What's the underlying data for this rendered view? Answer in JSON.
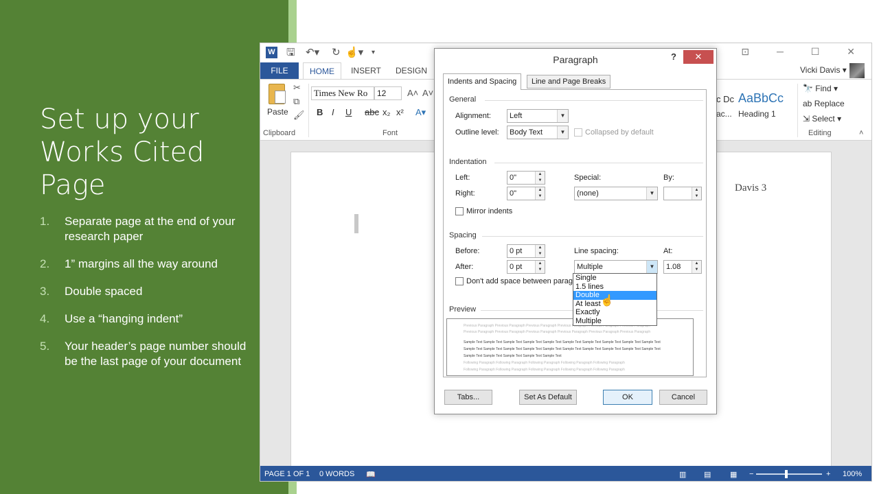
{
  "slide": {
    "title": "Set up your Works Cited Page",
    "items": [
      {
        "num": "1.",
        "text": "Separate page at the end of your research paper"
      },
      {
        "num": "2.",
        "text": "1” margins all the way around"
      },
      {
        "num": "3.",
        "text": "Double spaced"
      },
      {
        "num": "4.",
        "text": "Use a “hanging indent”"
      },
      {
        "num": "5.",
        "text": "Your header’s page number should be the last page of your document"
      }
    ],
    "colors": {
      "panel": "#548235",
      "accent": "#a9d18e"
    }
  },
  "word": {
    "app_badge": "W",
    "tabs": {
      "file": "FILE",
      "home": "HOME",
      "insert": "INSERT",
      "design": "DESIGN"
    },
    "user_name": "Vicki Davis ▾",
    "ribbon": {
      "paste_label": "Paste",
      "font_name": "Times New Ro",
      "font_size": "12",
      "bold": "B",
      "italic": "I",
      "underline": "U",
      "clipboard_label": "Clipboard",
      "font_label": "Font",
      "styles_preview_left": "c Dc",
      "styles_name_left": "ac...",
      "styles_preview": "AaBbCc",
      "styles_name": "Heading 1",
      "find": "Find ▾",
      "replace": "Replace",
      "select": "Select ▾",
      "editing_label": "Editing"
    },
    "doc": {
      "header_number": "Davis 3"
    },
    "status": {
      "page": "PAGE 1 OF 1",
      "words": "0 WORDS",
      "zoom": "100%"
    }
  },
  "dialog": {
    "title": "Paragraph",
    "help": "?",
    "close": "✕",
    "tabs": {
      "indents": "Indents and Spacing",
      "line_breaks": "Line and Page Breaks"
    },
    "general": {
      "heading": "General",
      "alignment_label": "Alignment:",
      "alignment_value": "Left",
      "outline_label": "Outline level:",
      "outline_value": "Body Text",
      "collapsed_label": "Collapsed by default"
    },
    "indentation": {
      "heading": "Indentation",
      "left_label": "Left:",
      "left_value": "0\"",
      "right_label": "Right:",
      "right_value": "0\"",
      "special_label": "Special:",
      "special_value": "(none)",
      "by_label": "By:",
      "by_value": "",
      "mirror_label": "Mirror indents"
    },
    "spacing": {
      "heading": "Spacing",
      "before_label": "Before:",
      "before_value": "0 pt",
      "after_label": "After:",
      "after_value": "0 pt",
      "line_spacing_label": "Line spacing:",
      "line_spacing_value": "Multiple",
      "at_label": "At:",
      "at_value": "1.08",
      "dont_add_label": "Don't add space between parag"
    },
    "line_spacing_options": [
      "Single",
      "1.5 lines",
      "Double",
      "At least",
      "Exactly",
      "Multiple"
    ],
    "highlighted_option_index": 2,
    "preview": {
      "heading": "Preview",
      "prev_para": "Previous Paragraph Previous Paragraph Previous Paragraph Previous Paragraph Previous Paragraph Previous Paragraph",
      "sample": "Sample Text Sample Text Sample Text Sample Text Sample Text Sample Text Sample Text Sample Text Sample Text Sample Text",
      "sample_end": "Sample Text Sample Text Sample Text Sample Text Sample Text",
      "following": "Following Paragraph Following Paragraph Following Paragraph Following Paragraph Following Paragraph"
    },
    "buttons": {
      "tabs": "Tabs...",
      "set_default": "Set As Default",
      "ok": "OK",
      "cancel": "Cancel"
    }
  }
}
